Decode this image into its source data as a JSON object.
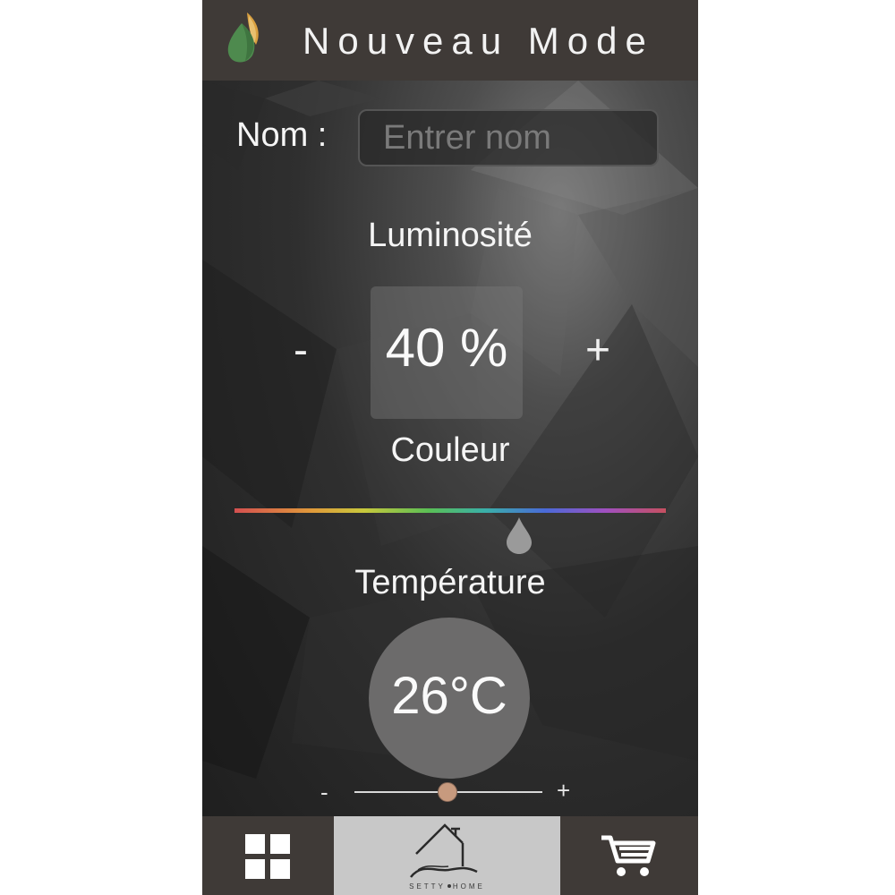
{
  "header": {
    "title": "Nouveau Mode",
    "logo_icon": "flame-leaf-icon"
  },
  "form": {
    "name_label": "Nom :",
    "name_value": "",
    "name_placeholder": "Entrer nom"
  },
  "brightness": {
    "label": "Luminosité",
    "value": "40 %",
    "minus": "-",
    "plus": "+"
  },
  "color": {
    "label": "Couleur",
    "slider_position": 0.66
  },
  "temperature": {
    "label": "Température",
    "value": "26°C",
    "minus": "-",
    "plus": "+",
    "slider_position": 0.49
  },
  "nav": {
    "left_icon": "grid-icon",
    "center_icon": "home-icon",
    "center_caption_left": "SETTY",
    "center_caption_right": "HOME",
    "right_icon": "cart-icon"
  },
  "colors": {
    "header_bg": "#3f3a37",
    "nav_center_bg": "#c8c8c8",
    "slider_thumb": "#c79a7e",
    "logo_green": "#4e8a4e",
    "logo_orange": "#d9a040"
  }
}
